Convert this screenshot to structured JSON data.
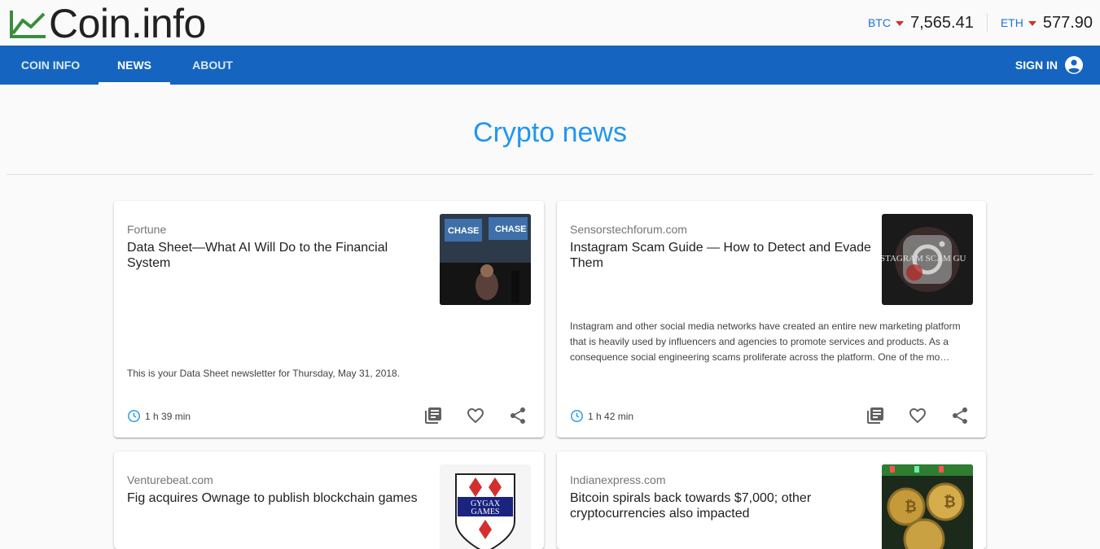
{
  "brand": {
    "name": "Coin.info"
  },
  "tickers": [
    {
      "symbol": "BTC",
      "price": "7,565.41",
      "trend": "down"
    },
    {
      "symbol": "ETH",
      "price": "577.90",
      "trend": "down"
    }
  ],
  "nav": {
    "tabs": [
      {
        "label": "COIN INFO",
        "active": false
      },
      {
        "label": "NEWS",
        "active": true
      },
      {
        "label": "ABOUT",
        "active": false
      }
    ],
    "signin_label": "SIGN IN"
  },
  "page": {
    "title": "Crypto news"
  },
  "colors": {
    "accent": "#2196f3",
    "nav_bg": "#1565c0",
    "down": "#d32f2f",
    "logo_green": "#388e3c"
  },
  "cards": [
    {
      "source": "Fortune",
      "title": "Data Sheet—What AI Will Do to the Financial System",
      "description": "This is your Data Sheet newsletter for Thursday, May 31, 2018.",
      "time": "1 h 39 min",
      "thumb_text": "CHASE"
    },
    {
      "source": "Sensorstechforum.com",
      "title": "Instagram Scam Guide — How to Detect and Evade Them",
      "description": "Instagram and other social media networks have created an entire new marketing platform that is heavily used by influencers and agencies to promote services and products. As a consequence social engineering scams proliferate across the platform. One of the mo…",
      "time": "1 h 42 min",
      "thumb_text": "STAGRAM SCAM GU"
    },
    {
      "source": "Venturebeat.com",
      "title": "Fig acquires Ownage to publish blockchain games",
      "description": "",
      "time": "",
      "thumb_text": "GYGAX GAMES"
    },
    {
      "source": "Indianexpress.com",
      "title": "Bitcoin spirals back towards $7,000; other cryptocurrencies also impacted",
      "description": "",
      "time": "",
      "thumb_text": ""
    }
  ]
}
